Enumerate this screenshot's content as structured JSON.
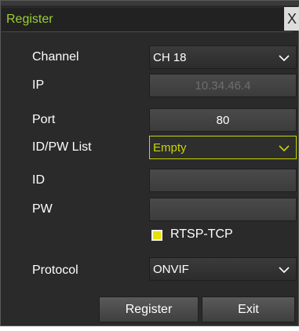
{
  "dialog": {
    "title": "Register",
    "close_glyph": "X"
  },
  "form": {
    "channel_label": "Channel",
    "channel_value": "CH 18",
    "ip_label": "IP",
    "ip_value": "10.34.46.4",
    "port_label": "Port",
    "port_value": "80",
    "idpw_label": "ID/PW List",
    "idpw_value": "Empty",
    "id_label": "ID",
    "id_value": "",
    "pw_label": "PW",
    "pw_value": "",
    "rtsp_label": "RTSP-TCP",
    "rtsp_checked": true,
    "protocol_label": "Protocol",
    "protocol_value": "ONVIF"
  },
  "buttons": {
    "register_label": "Register",
    "exit_label": "Exit"
  },
  "icons": {
    "dropdown": "chevron-down-icon",
    "close": "close-icon"
  },
  "colors": {
    "title_accent": "#9bd033",
    "active_border": "#c8d600",
    "checkbox_fill": "#e8e000",
    "panel_bg": "#2a2a2a"
  }
}
